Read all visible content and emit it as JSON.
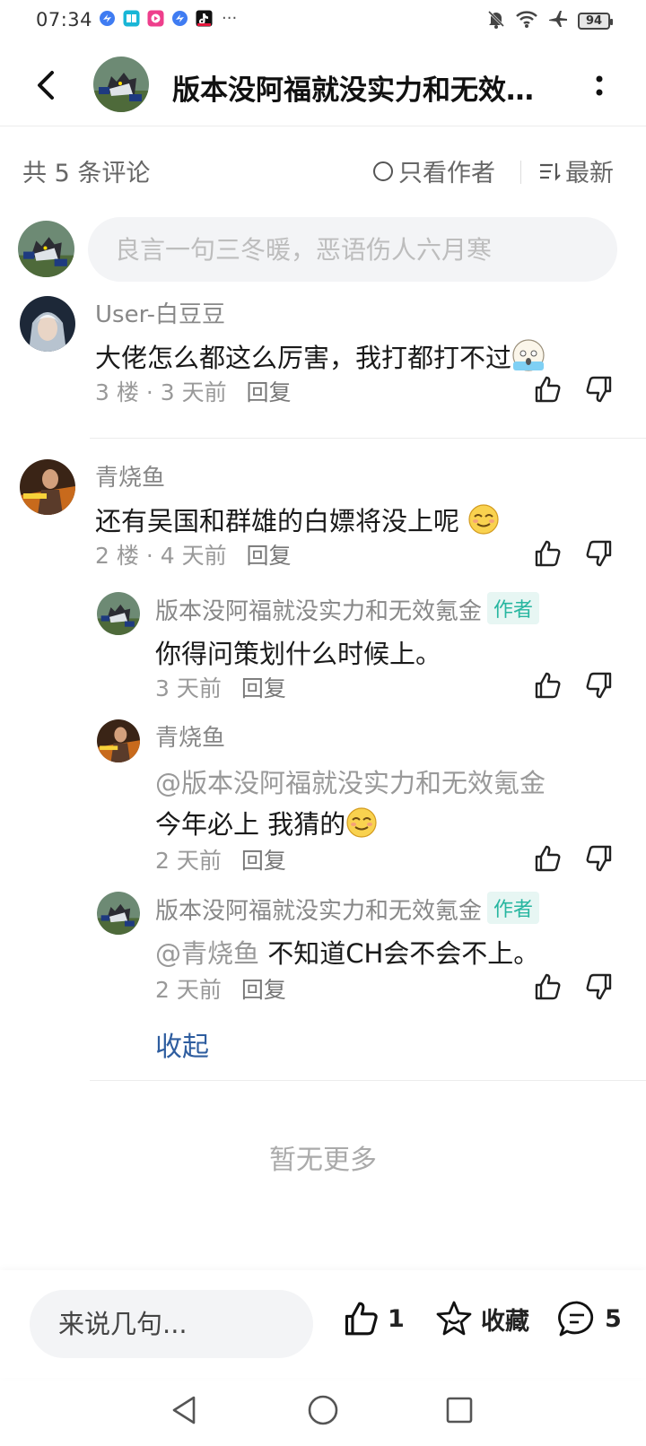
{
  "status_bar": {
    "time": "07:34",
    "battery": "94",
    "notification_icons": [
      "blue-app-icon",
      "book-app-icon",
      "video-app-icon",
      "blue-app-icon",
      "tiktok-icon"
    ],
    "overflow": "···",
    "right_icons": [
      "mute-bell-icon",
      "wifi-icon",
      "airplane-icon",
      "battery-icon"
    ]
  },
  "header": {
    "title": "版本没阿福就没实力和无效…"
  },
  "comment_bar": {
    "count": "共 5 条评论",
    "only_author": "只看作者",
    "sort": "最新"
  },
  "reply_input": {
    "placeholder": "良言一句三冬暖，恶语伤人六月寒"
  },
  "comments": [
    {
      "name": "User-白豆豆",
      "text": "大佬怎么都这么厉害，我打都打不过",
      "emoji": "scared-face",
      "floor": "3 楼",
      "sep": "·",
      "time": "3 天前",
      "reply": "回复"
    },
    {
      "name": "青烧鱼",
      "text": "还有吴国和群雄的白嫖将没上呢",
      "emoji": "smug-face",
      "floor": "2 楼",
      "sep": "·",
      "time": "4 天前",
      "reply": "回复",
      "replies": [
        {
          "name": "版本没阿福就没实力和无效氪金",
          "badge": "作者",
          "text": "你得问策划什么时候上。",
          "time": "3 天前",
          "reply": "回复"
        },
        {
          "name": "青烧鱼",
          "mention": "@版本没阿福就没实力和无效氪金",
          "text": "今年必上 我猜的",
          "emoji": "smug-face",
          "time": "2 天前",
          "reply": "回复"
        },
        {
          "name": "版本没阿福就没实力和无效氪金",
          "badge": "作者",
          "mention": "@青烧鱼",
          "text": "不知道CH会不会不上。",
          "time": "2 天前",
          "reply": "回复"
        }
      ],
      "collapse": "收起"
    }
  ],
  "no_more": "暂无更多",
  "bottom_bar": {
    "input_placeholder": "来说几句...",
    "like_count": "1",
    "favorite_label": "收藏",
    "comment_count": "5"
  },
  "colors": {
    "accent_link": "#2e5d9f",
    "author_badge": "#27b6a0",
    "muted_text": "#999999"
  }
}
